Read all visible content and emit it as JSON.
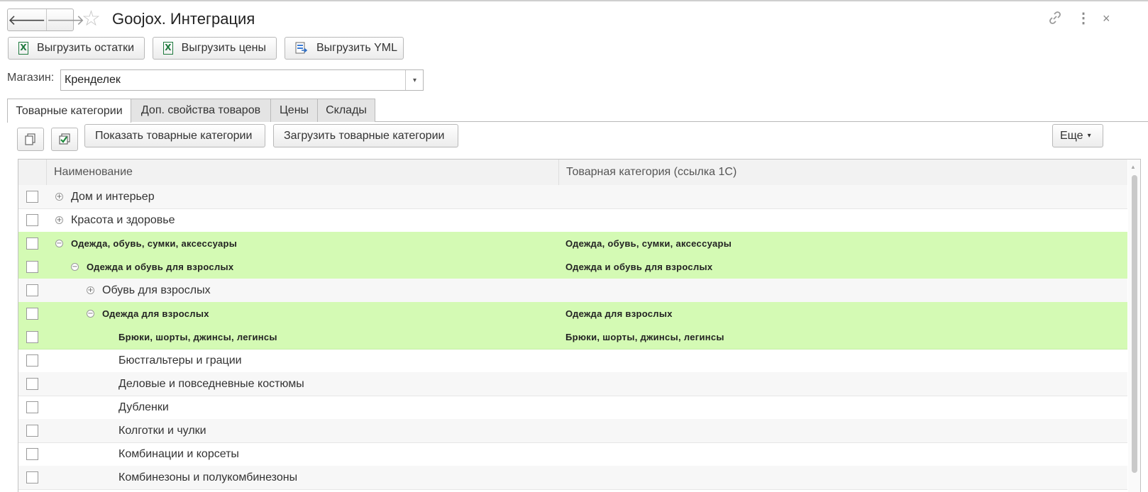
{
  "window": {
    "title": "Goojox. Интеграция",
    "back_icon": "arrow-left",
    "forward_icon": "arrow-right",
    "favorite_icon": "star-outline",
    "link_icon": "link",
    "menu_icon": "vertical-dots",
    "close_icon": "close",
    "back_glyph": "🡐",
    "forward_glyph": "🡒",
    "star_glyph": "☆",
    "link_glyph": "🔗",
    "menu_glyph": "⋮",
    "close_glyph": "×"
  },
  "toolbar": {
    "export_stock": "Выгрузить остатки",
    "export_prices": "Выгрузить цены",
    "export_yml": "Выгрузить YML",
    "excel_glyph": "X"
  },
  "shop": {
    "label": "Магазин:",
    "value": "Кренделек",
    "dropdown_glyph": "▾"
  },
  "tabs": [
    {
      "label": "Товарные категории",
      "active": true
    },
    {
      "label": "Доп. свойства товаров",
      "active": false
    },
    {
      "label": "Цены",
      "active": false
    },
    {
      "label": "Склады",
      "active": false
    }
  ],
  "categories_toolbar": {
    "show_button": "Показать товарные категории",
    "load_button": "Загрузить товарные категории",
    "more_button": "Еще",
    "more_glyph": "▾"
  },
  "table": {
    "columns": [
      "Наименование",
      "Товарная категория (ссылка 1С)"
    ],
    "rows": [
      {
        "name": "Дом и интерьер",
        "ref": "",
        "level": 0,
        "expander": "⊕",
        "highlighted": false
      },
      {
        "name": "Красота и здоровье",
        "ref": "",
        "level": 0,
        "expander": "⊕",
        "highlighted": false
      },
      {
        "name": "Одежда, обувь, сумки, аксессуары",
        "ref": "Одежда, обувь, сумки, аксессуары",
        "level": 0,
        "expander": "⊖",
        "highlighted": true
      },
      {
        "name": "Одежда и обувь для взрослых",
        "ref": "Одежда и обувь для взрослых",
        "level": 1,
        "expander": "⊖",
        "highlighted": true
      },
      {
        "name": "Обувь для взрослых",
        "ref": "",
        "level": 2,
        "expander": "⊕",
        "highlighted": false
      },
      {
        "name": "Одежда для взрослых",
        "ref": "Одежда для взрослых",
        "level": 2,
        "expander": "⊖",
        "highlighted": true
      },
      {
        "name": "Брюки, шорты, джинсы, легинсы",
        "ref": "Брюки, шорты, джинсы, легинсы",
        "level": 3,
        "expander": "",
        "highlighted": true
      },
      {
        "name": "Бюстгальтеры и грации",
        "ref": "",
        "level": 3,
        "expander": "",
        "highlighted": false
      },
      {
        "name": "Деловые и повседневные костюмы",
        "ref": "",
        "level": 3,
        "expander": "",
        "highlighted": false
      },
      {
        "name": "Дубленки",
        "ref": "",
        "level": 3,
        "expander": "",
        "highlighted": false
      },
      {
        "name": "Колготки и чулки",
        "ref": "",
        "level": 3,
        "expander": "",
        "highlighted": false
      },
      {
        "name": "Комбинации и корсеты",
        "ref": "",
        "level": 3,
        "expander": "",
        "highlighted": false
      },
      {
        "name": "Комбинезоны и полукомбинезоны",
        "ref": "",
        "level": 3,
        "expander": "",
        "highlighted": false
      }
    ]
  },
  "colors": {
    "highlight": "#d4fab4",
    "excel_green": "#1e7a3d"
  }
}
